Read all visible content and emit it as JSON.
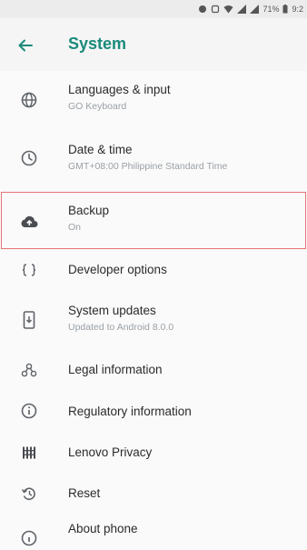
{
  "status_bar": {
    "battery": "71%",
    "time": "9:2"
  },
  "header": {
    "title": "System"
  },
  "items": [
    {
      "title": "Languages & input",
      "subtitle": "GO Keyboard",
      "icon": "globe-icon"
    },
    {
      "title": "Date & time",
      "subtitle": "GMT+08:00 Philippine Standard Time",
      "icon": "clock-icon"
    },
    {
      "title": "Backup",
      "subtitle": "On",
      "icon": "cloud-upload-icon",
      "selected": true
    },
    {
      "title": "Developer options",
      "subtitle": "",
      "icon": "braces-icon"
    },
    {
      "title": "System updates",
      "subtitle": "Updated to Android 8.0.0",
      "icon": "system-update-icon"
    },
    {
      "title": "Legal information",
      "subtitle": "",
      "icon": "legal-icon"
    },
    {
      "title": "Regulatory information",
      "subtitle": "",
      "icon": "info-icon"
    },
    {
      "title": "Lenovo Privacy",
      "subtitle": "",
      "icon": "privacy-grid-icon"
    },
    {
      "title": "Reset",
      "subtitle": "",
      "icon": "reset-icon"
    },
    {
      "title": "About phone",
      "subtitle": "",
      "icon": "phone-info-icon"
    }
  ],
  "colors": {
    "accent": "#1a8a7a",
    "selection_outline": "#e57373"
  }
}
